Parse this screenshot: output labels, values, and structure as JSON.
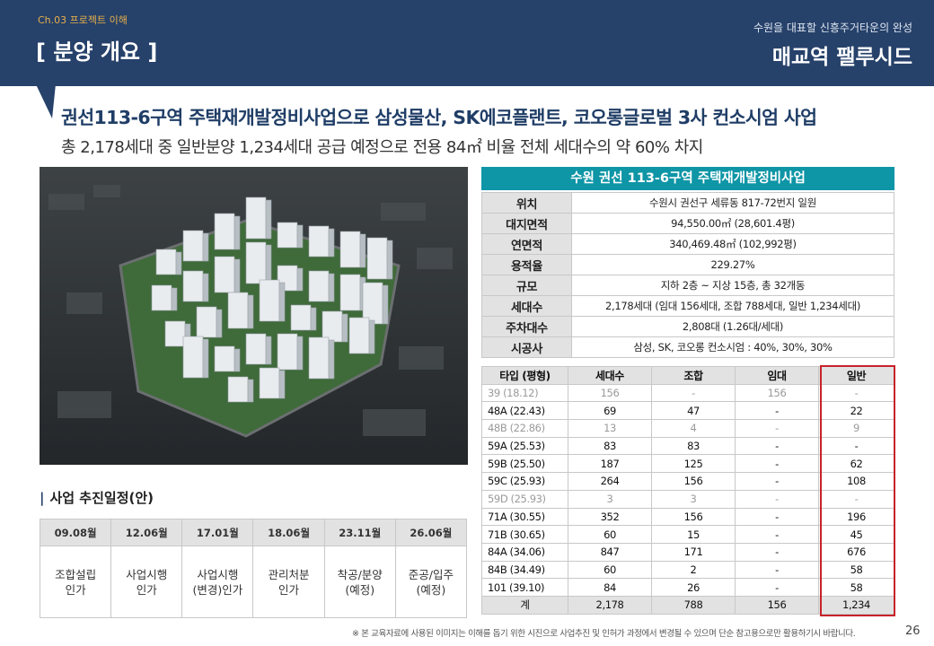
{
  "header": {
    "chapter": "Ch.03 프로젝트 이해",
    "section_title": "[ 분양 개요 ]",
    "tagline": "수원을 대표할 신흥주거타운의 완성",
    "brand": "매교역 팰루시드"
  },
  "headline": "권선113-6구역 주택재개발정비사업으로 삼성물산, SK에코플랜트, 코오롱글로벌 3사 컨소시엄 사업",
  "subline": "총 2,178세대 중 일반분양 1,234세대 공급 예정으로 전용 84㎡ 비율 전체 세대수의 약 60% 차지",
  "info": {
    "title": "수원 권선 113-6구역 주택재개발정비사업",
    "rows": [
      {
        "label": "위치",
        "value": "수원시 권선구 세류동 817-72번지 일원"
      },
      {
        "label": "대지면적",
        "value": "94,550.00㎡ (28,601.4평)"
      },
      {
        "label": "연면적",
        "value": "340,469.48㎡ (102,992평)"
      },
      {
        "label": "용적율",
        "value": "229.27%"
      },
      {
        "label": "규모",
        "value": "지하 2층 ~ 지상 15층, 총 32개동"
      },
      {
        "label": "세대수",
        "value": "2,178세대 (임대 156세대, 조합 788세대, 일반 1,234세대)"
      },
      {
        "label": "주차대수",
        "value": "2,808대 (1.26대/세대)"
      },
      {
        "label": "시공사",
        "value": "삼성, SK, 코오롱 컨소시엄 : 40%, 30%, 30%"
      }
    ]
  },
  "units": {
    "headers": [
      "타입 (평형)",
      "세대수",
      "조합",
      "임대",
      "일반"
    ],
    "rows": [
      [
        "39  (18.12)",
        "156",
        "-",
        "156",
        "-"
      ],
      [
        "48A (22.43)",
        "69",
        "47",
        "-",
        "22"
      ],
      [
        "48B (22.86)",
        "13",
        "4",
        "-",
        "9"
      ],
      [
        "59A (25.53)",
        "83",
        "83",
        "-",
        "-"
      ],
      [
        "59B (25.50)",
        "187",
        "125",
        "-",
        "62"
      ],
      [
        "59C (25.93)",
        "264",
        "156",
        "-",
        "108"
      ],
      [
        "59D (25.93)",
        "3",
        "3",
        "-",
        "-"
      ],
      [
        "71A (30.55)",
        "352",
        "156",
        "-",
        "196"
      ],
      [
        "71B (30.65)",
        "60",
        "15",
        "-",
        "45"
      ],
      [
        "84A (34.06)",
        "847",
        "171",
        "-",
        "676"
      ],
      [
        "84B (34.49)",
        "60",
        "2",
        "-",
        "58"
      ],
      [
        "101 (39.10)",
        "84",
        "26",
        "-",
        "58"
      ]
    ],
    "total": [
      "계",
      "2,178",
      "788",
      "156",
      "1,234"
    ]
  },
  "schedule": {
    "heading": "사업 추진일정(안)",
    "dates": [
      "09.08월",
      "12.06월",
      "17.01월",
      "18.06월",
      "23.11월",
      "26.06월"
    ],
    "events": [
      [
        "조합설립",
        "인가"
      ],
      [
        "사업시행",
        "인가"
      ],
      [
        "사업시행",
        "(변경)인가"
      ],
      [
        "관리처분",
        "인가"
      ],
      [
        "착공/분양",
        "(예정)"
      ],
      [
        "준공/입주",
        "(예정)"
      ]
    ]
  },
  "footnote": "※ 본 교육자료에 사용된 이미지는 이해를 돕기 위한 시진으로 사업추진 및 인허가 과정에서 변경될 수 있으며 단순 참고용으로만 활용하기시 바랍니다.",
  "page_number": "26",
  "colors": {
    "header_bg": "#26416a",
    "accent_teal": "#0e95a6",
    "highlight_red": "#c8222a",
    "chapter_gold": "#e8b04a"
  }
}
